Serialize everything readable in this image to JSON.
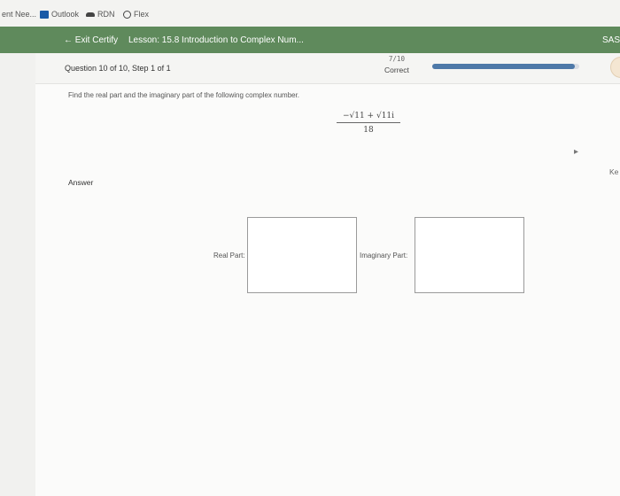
{
  "bookmarks": {
    "items": [
      {
        "label": "ent Nee..."
      },
      {
        "label": "Outlook"
      },
      {
        "label": "RDN"
      },
      {
        "label": "Flex"
      }
    ]
  },
  "topbar": {
    "exit_label": "Exit Certify",
    "lesson_title": "Lesson: 15.8 Introduction to Complex Num...",
    "user_initials": "SASH"
  },
  "question": {
    "label": "Question 10 of 10, Step 1 of 1",
    "score": "7/10",
    "status": "Correct",
    "progress": 0.97,
    "prompt": "Find the real part and the imaginary part of the following complex number.",
    "expression_numerator": "−√11 + √11i",
    "expression_denominator": "18"
  },
  "answer": {
    "label": "Answer",
    "real_label": "Real Part:",
    "imag_label": "Imaginary Part:",
    "real_value": "",
    "imag_value": ""
  },
  "side": {
    "right_text": "Ke"
  },
  "colors": {
    "topbar": "#5f8a5c",
    "progress": "#4e79a8"
  }
}
